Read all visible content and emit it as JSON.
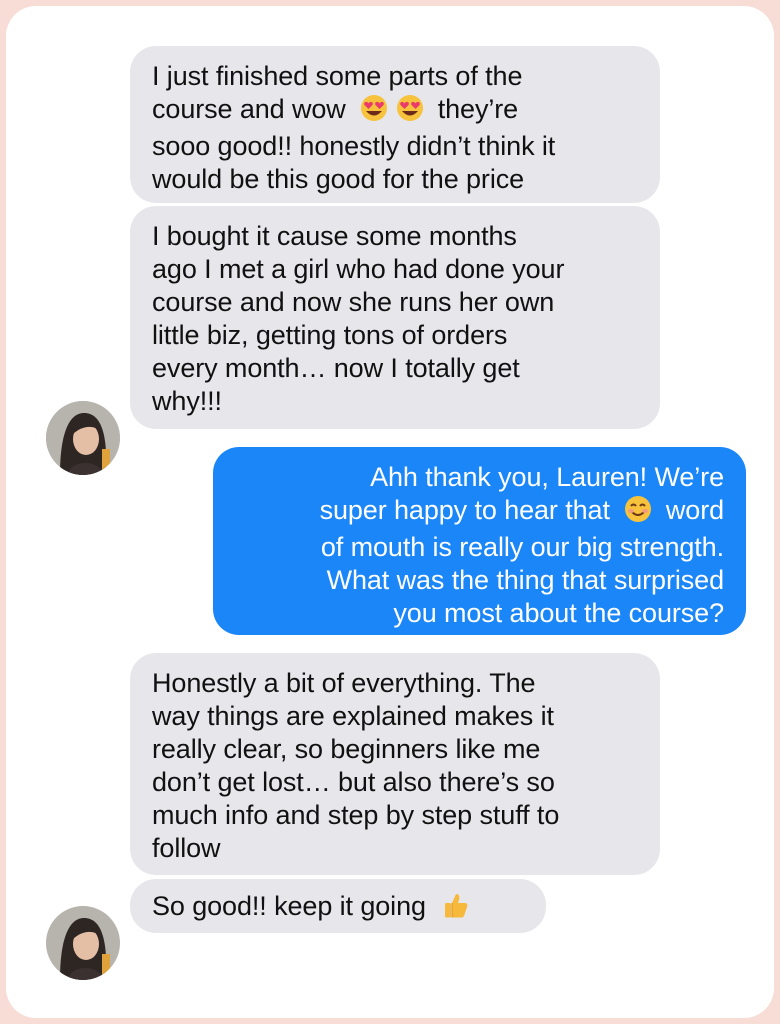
{
  "conversation": {
    "messages": [
      {
        "sender": "them",
        "lines": [
          "I just finished some parts of the",
          "course and wow",
          "they’re",
          "sooo good!! honestly didn’t think it",
          "would be this good for the price"
        ],
        "emoji": [
          "heart-eyes",
          "heart-eyes"
        ]
      },
      {
        "sender": "them",
        "lines": [
          "I bought it cause some months",
          "ago I met a girl who had done your",
          "course and now she runs her own",
          "little biz, getting tons of orders",
          "every month… now I totally get",
          "why!!!"
        ]
      },
      {
        "sender": "me",
        "lines": [
          "Ahh thank you, Lauren! We’re",
          "super happy to hear that",
          "word",
          "of mouth is really our big strength.",
          "What was the thing that surprised",
          "you most about the course?"
        ],
        "emoji": [
          "smiling-face"
        ]
      },
      {
        "sender": "them",
        "lines": [
          "Honestly a bit of everything. The",
          "way things are explained makes it",
          "really clear, so beginners like me",
          "don’t get lost… but also there’s so",
          "much info and step by step stuff to",
          "follow"
        ]
      },
      {
        "sender": "them",
        "lines": [
          "So good!! keep it going"
        ],
        "emoji": [
          "thumbs-up"
        ]
      }
    ],
    "colors": {
      "incoming_bubble": "#e7e7eb",
      "outgoing_bubble": "#1a86f8",
      "frame_border": "#f7ddd6"
    }
  }
}
